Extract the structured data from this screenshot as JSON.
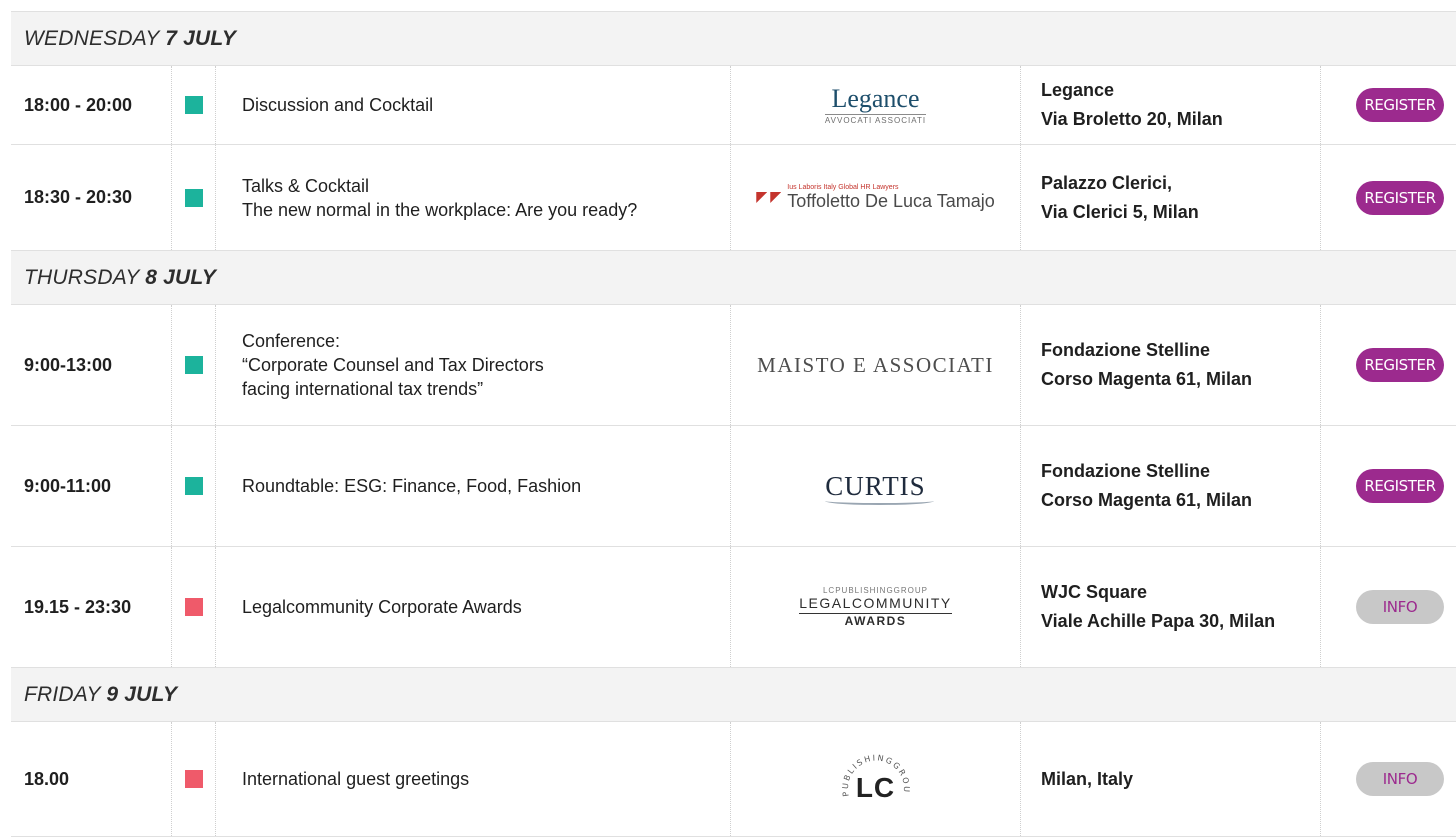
{
  "days": [
    {
      "label_prefix": "WEDNESDAY",
      "label_bold": "7 JULY",
      "events": [
        {
          "time": "18:00 - 20:00",
          "marker_color": "#1cb39c",
          "title_lines": [
            "Discussion and Cocktail"
          ],
          "logo": {
            "type": "legance",
            "word": "Legance",
            "sub": "AVVOCATI ASSOCIATI"
          },
          "venue_lines": [
            "Legance",
            "Via Broletto 20, Milan"
          ],
          "action": {
            "type": "register",
            "label": "REGISTER"
          }
        },
        {
          "time": "18:30 - 20:30",
          "marker_color": "#1cb39c",
          "title_lines": [
            "Talks & Cocktail",
            "The new normal in the workplace: Are you ready?"
          ],
          "logo": {
            "type": "toffoletto",
            "tag": "Ius Laboris Italy Global HR Lawyers",
            "name": "Toffoletto De Luca Tamajo"
          },
          "venue_lines": [
            "Palazzo Clerici,",
            "Via Clerici 5, Milan"
          ],
          "action": {
            "type": "register",
            "label": "REGISTER"
          }
        }
      ]
    },
    {
      "label_prefix": "THURSDAY",
      "label_bold": "8 JULY",
      "events": [
        {
          "time": "9:00-13:00",
          "marker_color": "#1cb39c",
          "title_lines": [
            "Conference:",
            "“Corporate Counsel and Tax Directors",
            "facing international tax trends”"
          ],
          "logo": {
            "type": "maisto",
            "word": "MAISTO E ASSOCIATI"
          },
          "venue_lines": [
            "Fondazione Stelline",
            "Corso Magenta 61, Milan"
          ],
          "action": {
            "type": "register",
            "label": "REGISTER"
          }
        },
        {
          "time": "9:00-11:00",
          "marker_color": "#1cb39c",
          "title_lines": [
            "Roundtable:  ESG: Finance, Food, Fashion"
          ],
          "logo": {
            "type": "curtis",
            "word": "CURTIS"
          },
          "venue_lines": [
            "Fondazione Stelline",
            "Corso Magenta 61, Milan"
          ],
          "action": {
            "type": "register",
            "label": "REGISTER"
          }
        },
        {
          "time": "19.15 - 23:30",
          "marker_color": "#ef5a6a",
          "title_lines": [
            "Legalcommunity Corporate Awards"
          ],
          "logo": {
            "type": "legalcommunity",
            "top": "LCPUBLISHINGGROUP",
            "word": "LEGALCOMMUNITY",
            "sub": "AWARDS"
          },
          "venue_lines": [
            "WJC Square",
            "Viale Achille Papa 30, Milan"
          ],
          "action": {
            "type": "info",
            "label": "INFO"
          }
        }
      ]
    },
    {
      "label_prefix": "FRIDAY",
      "label_bold": "9 JULY",
      "events": [
        {
          "time": "18.00",
          "marker_color": "#ef5a6a",
          "title_lines": [
            "International guest greetings"
          ],
          "logo": {
            "type": "lcpg",
            "ring": "PUBLISHINGGROUP",
            "mono": "LC"
          },
          "venue_lines": [
            "Milan, Italy"
          ],
          "action": {
            "type": "info",
            "label": "INFO"
          }
        }
      ]
    }
  ]
}
